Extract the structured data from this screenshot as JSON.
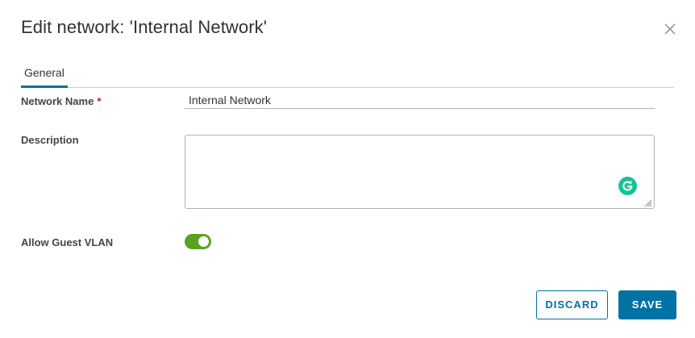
{
  "dialog": {
    "title": "Edit network: 'Internal Network'",
    "close_icon": "close-icon"
  },
  "tabs": [
    {
      "label": "General",
      "active": true
    }
  ],
  "form": {
    "network_name": {
      "label": "Network Name",
      "required_marker": "*",
      "value": "Internal Network"
    },
    "description": {
      "label": "Description",
      "value": "",
      "extension_icon": "grammarly-icon"
    },
    "allow_guest_vlan": {
      "label": "Allow Guest VLAN",
      "enabled": true
    }
  },
  "footer": {
    "discard_label": "DISCARD",
    "save_label": "SAVE"
  },
  "colors": {
    "accent": "#0072a3",
    "toggle_on": "#5aa220",
    "required": "#c21d00",
    "grammarly": "#15c39a"
  }
}
